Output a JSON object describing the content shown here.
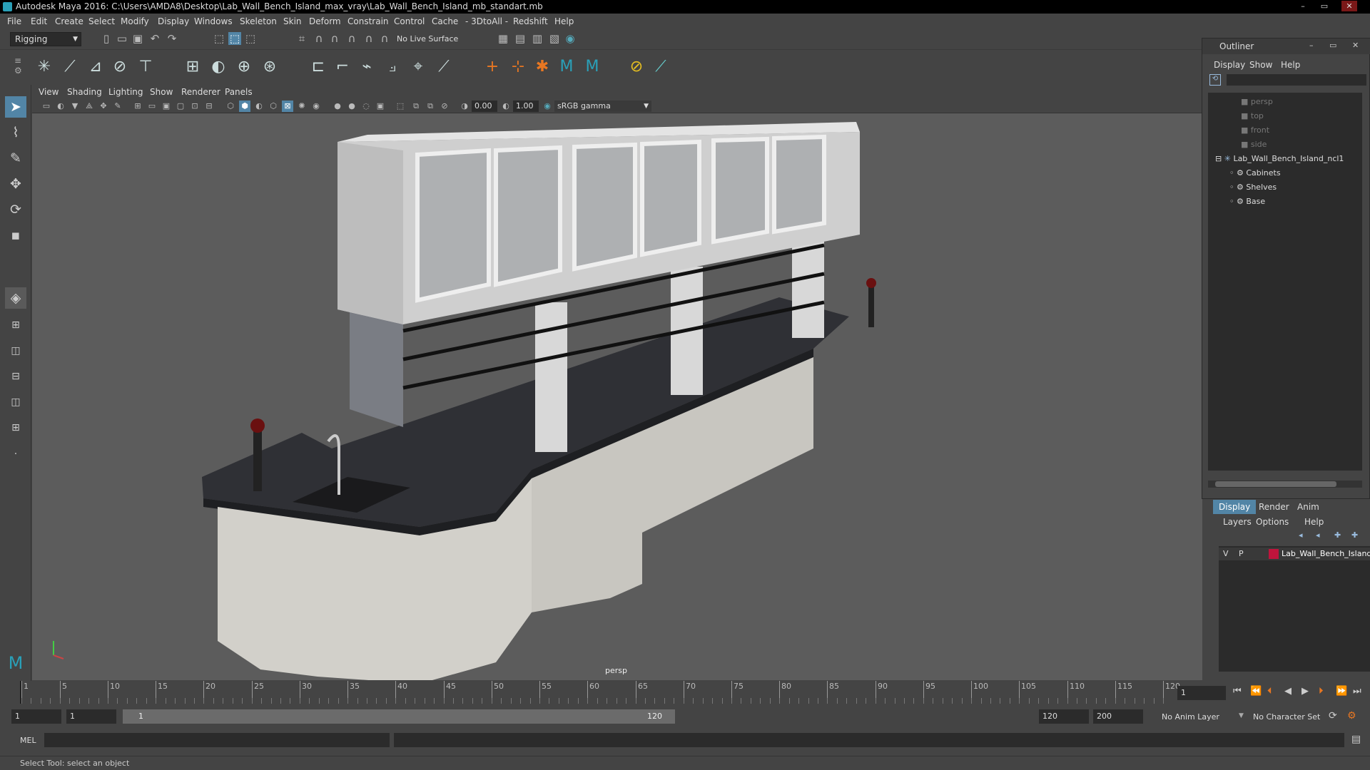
{
  "window": {
    "title": "Autodesk Maya 2016: C:\\Users\\AMDA8\\Desktop\\Lab_Wall_Bench_Island_max_vray\\Lab_Wall_Bench_Island_mb_standart.mb",
    "minimize": "–",
    "maximize": "▭",
    "close": "✕"
  },
  "menubar": [
    "File",
    "Edit",
    "Create",
    "Select",
    "Modify",
    "Display",
    "Windows",
    "Skeleton",
    "Skin",
    "Deform",
    "Constrain",
    "Control",
    "Cache",
    "- 3DtoAll -",
    "Redshift",
    "Help"
  ],
  "statusline": {
    "mode": "Rigging",
    "live_surface": "No Live Surface"
  },
  "panel": {
    "menus": [
      "View",
      "Shading",
      "Lighting",
      "Show",
      "Renderer",
      "Panels"
    ],
    "exposure": "0.00",
    "gamma": "1.00",
    "color_space": "sRGB gamma",
    "camera": "persp"
  },
  "outliner": {
    "title": "Outliner",
    "menus": [
      "Display",
      "Show",
      "Help"
    ],
    "cameras": [
      "persp",
      "top",
      "front",
      "side"
    ],
    "root": "Lab_Wall_Bench_Island_ncl1",
    "children": [
      "Cabinets",
      "Shelves",
      "Base"
    ]
  },
  "layer_editor": {
    "tabs": [
      "Display",
      "Render",
      "Anim"
    ],
    "menus": [
      "Layers",
      "Options",
      "Help"
    ],
    "layer": {
      "v": "V",
      "p": "P",
      "name": "Lab_Wall_Bench_Island",
      "color": "#c0143c"
    }
  },
  "timeline": {
    "ticks": [
      "1",
      "5",
      "10",
      "15",
      "20",
      "25",
      "30",
      "35",
      "40",
      "45",
      "50",
      "55",
      "60",
      "65",
      "70",
      "75",
      "80",
      "85",
      "90",
      "95",
      "100",
      "105",
      "110",
      "115",
      "120"
    ],
    "current_frame": "1"
  },
  "range": {
    "start": "1",
    "playback_start": "1",
    "slider_start": "1",
    "slider_end": "120",
    "playback_end": "120",
    "end": "200",
    "anim_layer": "No Anim Layer",
    "character_set": "No Character Set"
  },
  "command": {
    "lang": "MEL"
  },
  "help_line": "Select Tool: select an object",
  "colors": {
    "accent": "#5285a6",
    "viewport": "#5c5c5c",
    "panel": "#444444"
  }
}
